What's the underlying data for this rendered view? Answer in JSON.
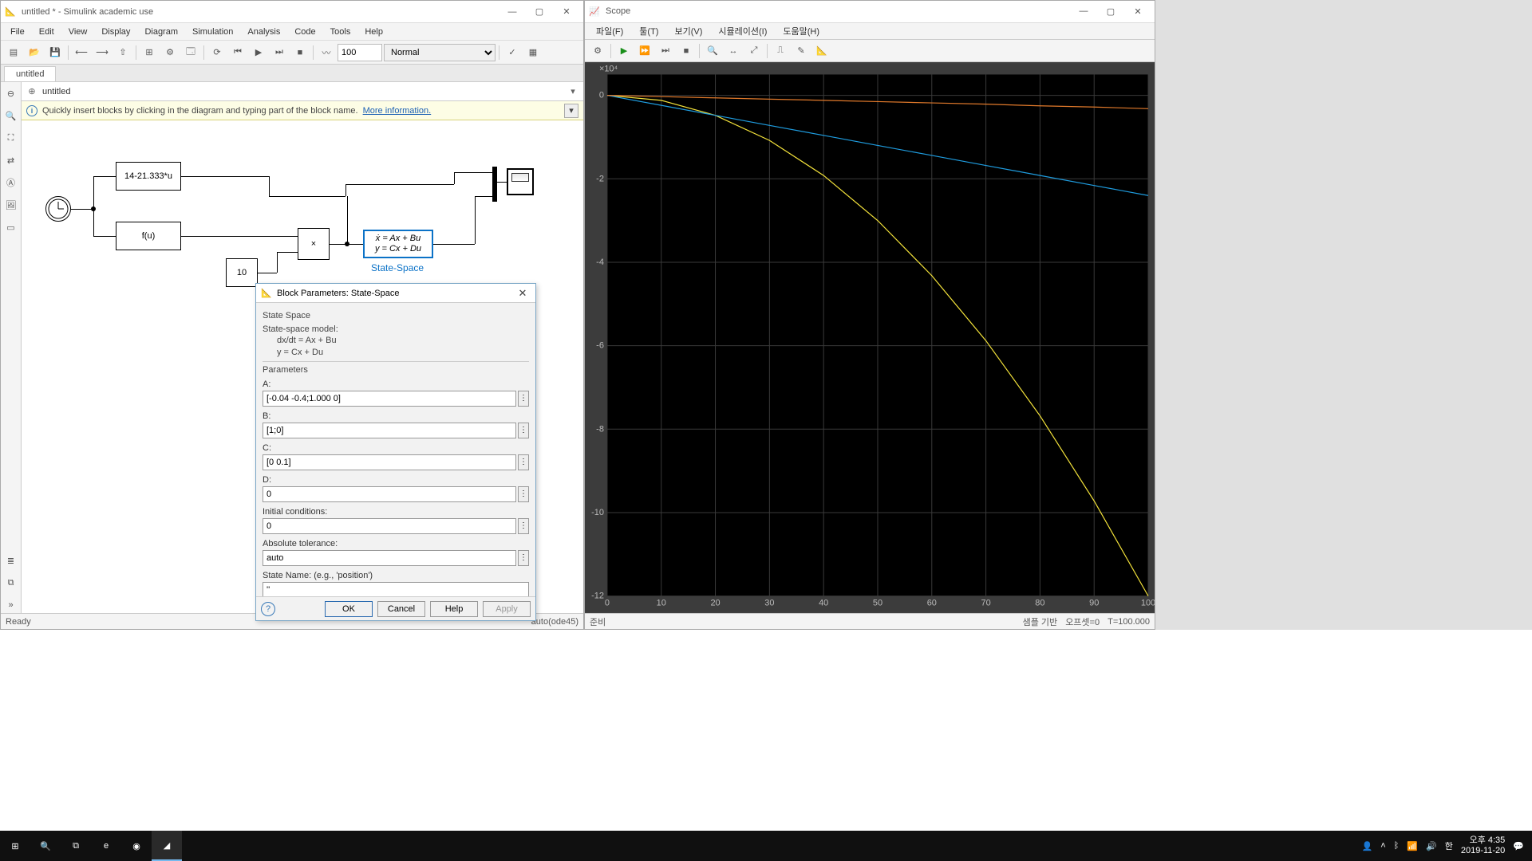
{
  "simulink": {
    "title": "untitled * - Simulink academic use",
    "menus": [
      "File",
      "Edit",
      "View",
      "Display",
      "Diagram",
      "Simulation",
      "Analysis",
      "Code",
      "Tools",
      "Help"
    ],
    "stopTime": "100",
    "mode": "Normal",
    "tab": "untitled",
    "breadcrumb": "untitled",
    "hint": "Quickly insert blocks by clicking in the diagram and typing part of the block name.",
    "hintLink": "More information.",
    "blocks": {
      "fcn1": "14-21.333*u",
      "fcn2": "f(u)",
      "const": "10",
      "product": "×",
      "ss_line1": "ẋ = Ax + Bu",
      "ss_line2": "y = Cx + Du",
      "ss_label": "State-Space"
    },
    "status": {
      "left": "Ready",
      "right": "auto(ode45)"
    }
  },
  "dialog": {
    "title": "Block Parameters: State-Space",
    "section": "State Space",
    "desc1": "State-space model:",
    "desc2": "dx/dt = Ax + Bu",
    "desc3": "y = Cx + Du",
    "paramsHeader": "Parameters",
    "labels": {
      "A": "A:",
      "B": "B:",
      "C": "C:",
      "D": "D:",
      "IC": "Initial conditions:",
      "AT": "Absolute tolerance:",
      "SN": "State Name: (e.g., 'position')"
    },
    "values": {
      "A": "[-0.04 -0.4;1.000 0]",
      "B": "[1;0]",
      "C": "[0 0.1]",
      "D": "0",
      "IC": "0",
      "AT": "auto",
      "SN": "''"
    },
    "buttons": {
      "ok": "OK",
      "cancel": "Cancel",
      "help": "Help",
      "apply": "Apply"
    }
  },
  "scope": {
    "title": "Scope",
    "menus": [
      "파일(F)",
      "툴(T)",
      "보기(V)",
      "시뮬레이션(I)",
      "도움말(H)"
    ],
    "status": {
      "left": "준비",
      "mid": "샘플 기반",
      "offset": "오프셋=0",
      "t": "T=100.000"
    },
    "axis_exp": "×10⁴"
  },
  "chart_data": {
    "type": "line",
    "title": "",
    "xlabel": "",
    "ylabel": "",
    "xlim": [
      0,
      100
    ],
    "ylim": [
      -12,
      0.5
    ],
    "xticks": [
      0,
      10,
      20,
      30,
      40,
      50,
      60,
      70,
      80,
      90,
      100
    ],
    "yticks": [
      0,
      -2,
      -4,
      -6,
      -8,
      -10,
      -12
    ],
    "y_scale_label": "×10⁴",
    "series": [
      {
        "name": "yellow",
        "color": "#f5e43b",
        "x": [
          0,
          10,
          20,
          30,
          40,
          50,
          60,
          70,
          80,
          90,
          100
        ],
        "y": [
          0,
          -0.12,
          -0.48,
          -1.08,
          -1.92,
          -3.0,
          -4.32,
          -5.88,
          -7.68,
          -9.72,
          -12.0
        ]
      },
      {
        "name": "blue",
        "color": "#1f9de0",
        "x": [
          0,
          10,
          20,
          30,
          40,
          50,
          60,
          70,
          80,
          90,
          100
        ],
        "y": [
          0,
          -0.24,
          -0.48,
          -0.72,
          -0.96,
          -1.2,
          -1.44,
          -1.68,
          -1.92,
          -2.16,
          -2.4
        ]
      },
      {
        "name": "orange",
        "color": "#e27a2b",
        "x": [
          0,
          10,
          20,
          30,
          40,
          50,
          60,
          70,
          80,
          90,
          100
        ],
        "y": [
          0,
          -0.03,
          -0.06,
          -0.09,
          -0.12,
          -0.15,
          -0.18,
          -0.21,
          -0.25,
          -0.28,
          -0.32
        ]
      }
    ]
  },
  "taskbar": {
    "time": "오후 4:35",
    "date": "2019-11-20"
  }
}
